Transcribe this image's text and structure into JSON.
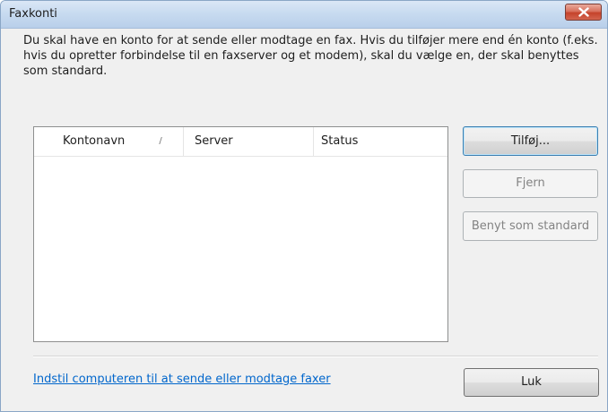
{
  "window": {
    "title": "Faxkonti"
  },
  "description": "Du skal have en konto for at sende eller modtage en fax. Hvis du tilføjer mere end én konto (f.eks. hvis du opretter forbindelse til en faxserver og et modem), skal du vælge en, der skal benyttes som standard.",
  "listview": {
    "columns": [
      "Kontonavn",
      "Server",
      "Status"
    ],
    "sort_indicator": "/",
    "rows": []
  },
  "buttons": {
    "add": "Tilføj...",
    "remove": "Fjern",
    "set_default": "Benyt som standard",
    "close": "Luk"
  },
  "link": {
    "text": "Indstil computeren til at sende eller modtage faxer"
  },
  "colors": {
    "link": "#0066cc",
    "close_button": "#c5432b",
    "titlebar": "#c8dbf0"
  },
  "icons": {
    "close": "close-x-icon"
  }
}
